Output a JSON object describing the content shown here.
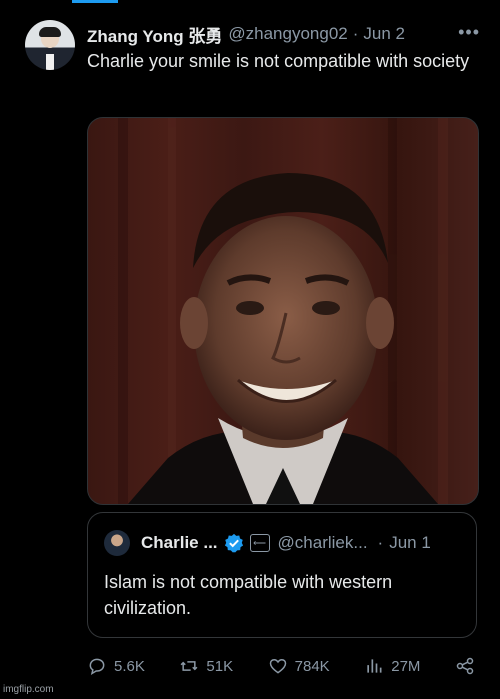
{
  "author": {
    "name": "Zhang Yong 张勇",
    "handle": "@zhangyong02",
    "date": "Jun 2"
  },
  "tweet": {
    "text": "Charlie your smile is not compatible with society"
  },
  "menu": {
    "more_icon": "more-dots-icon"
  },
  "quote": {
    "name": "Charlie ...",
    "handle": "@charliek...",
    "date": "Jun 1",
    "text": "Islam is not compatible with western civilization.",
    "verified_color": "#1d9bf0"
  },
  "actions": {
    "replies": "5.6K",
    "retweets": "51K",
    "likes": "784K",
    "views": "27M"
  },
  "watermark": "imgflip.com",
  "colors": {
    "background": "#000000",
    "text": "#e7e9ea",
    "secondary": "#8b98a5",
    "accent": "#1d9bf0"
  }
}
